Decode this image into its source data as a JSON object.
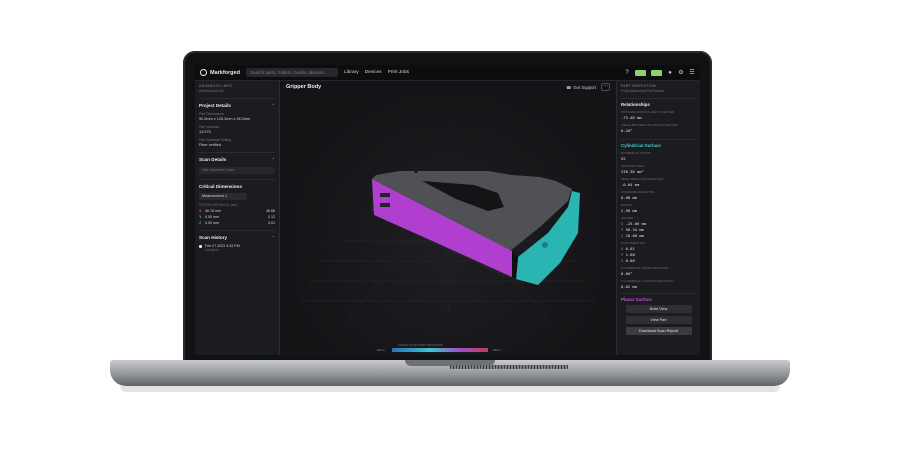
{
  "app": {
    "brand": "Markforged",
    "search_placeholder": "Search parts, folders, builds, devices...",
    "nav": [
      "Library",
      "Devices",
      "Print Jobs"
    ]
  },
  "left_panel": {
    "adv_label": "ADVANCED INFO",
    "adv_sub": "Additive/part info",
    "project": {
      "title": "Project Details",
      "k1": "Part Dimensions",
      "v1": "90.0mm x 125.3mm x 36.2mm",
      "k2": "Part Variance",
      "v2": "13,975",
      "k3": "Part Variance/Tooling",
      "v3": "Fiber verified"
    },
    "scan": {
      "title": "Scan Details",
      "input": "Add Inspection Notes..."
    },
    "critical": {
      "title": "Critical Dimensions",
      "dropdown": "Measurement 1",
      "header": "CENTER DISTANCE (mm)",
      "rows": [
        {
          "axis": "X",
          "v1": "46.78  mm",
          "v2": "46.68"
        },
        {
          "axis": "Y",
          "v1": "0.00  mm",
          "v2": "0.12"
        },
        {
          "axis": "Z",
          "v1": "0.00  mm",
          "v2": "0.01"
        }
      ]
    },
    "history": {
      "title": "Scan History",
      "date": "Feb 27 2023 3:43 PM",
      "sub": "Complete"
    }
  },
  "viewport": {
    "title": "Gripper Body",
    "support": "Get Support",
    "legend_caption": "CHECK SCAN PART DEVIATION",
    "legend_min": "-20um",
    "legend_max": "20um"
  },
  "right_panel": {
    "label": "PART INSPECTION",
    "sub": "Project/Assembly/Part/Surface",
    "relationships": {
      "title": "Relationships",
      "k1": "DISTANCE FROM PLANE TO CENTER",
      "v1": "-75.48 mm",
      "k2": "ANGLE BETWEEN PLANE AND CENTER",
      "v2": "0.20°"
    },
    "cylindrical": {
      "title": "Cylindrical Surface",
      "items": [
        {
          "k": "NUMBER OF POINTS",
          "v": "52"
        },
        {
          "k": "SURFACE AREA",
          "v": "230.38 mm²"
        },
        {
          "k": "MEAN ABSOLUTE DEVIATION",
          "v": "-0.04 mm"
        },
        {
          "k": "STANDARD DEVIATION",
          "v": "0.08 mm"
        },
        {
          "k": "RADIUS",
          "v": "2.56 mm"
        }
      ],
      "center_k": "CENTER",
      "center": [
        {
          "axis": "X",
          "v": "-25.00 mm"
        },
        {
          "axis": "Y",
          "v": "50.34 mm"
        },
        {
          "axis": "Z",
          "v": "18.00 mm"
        }
      ],
      "dir_k": "AXIS DIRECTION",
      "dir": [
        {
          "axis": "X",
          "v": "0.01"
        },
        {
          "axis": "Y",
          "v": "1.00"
        },
        {
          "axis": "Z",
          "v": "0.00"
        }
      ],
      "cyl_k": "CYLINDRICAL ANGLE DEVIATION",
      "cyl_v": "0.06°",
      "cyl2_k": "CYLINDRICAL LOCATION DEVIATION",
      "cyl2_v": "0.02 mm"
    },
    "planar_title": "Planar Surface",
    "buttons": [
      "Build View",
      "View Part",
      "Download Scan Report"
    ]
  },
  "colors": {
    "magenta_face": "#b03fd0",
    "cyan_face": "#2bb5b2",
    "body_gray": "#4a4b4f"
  }
}
